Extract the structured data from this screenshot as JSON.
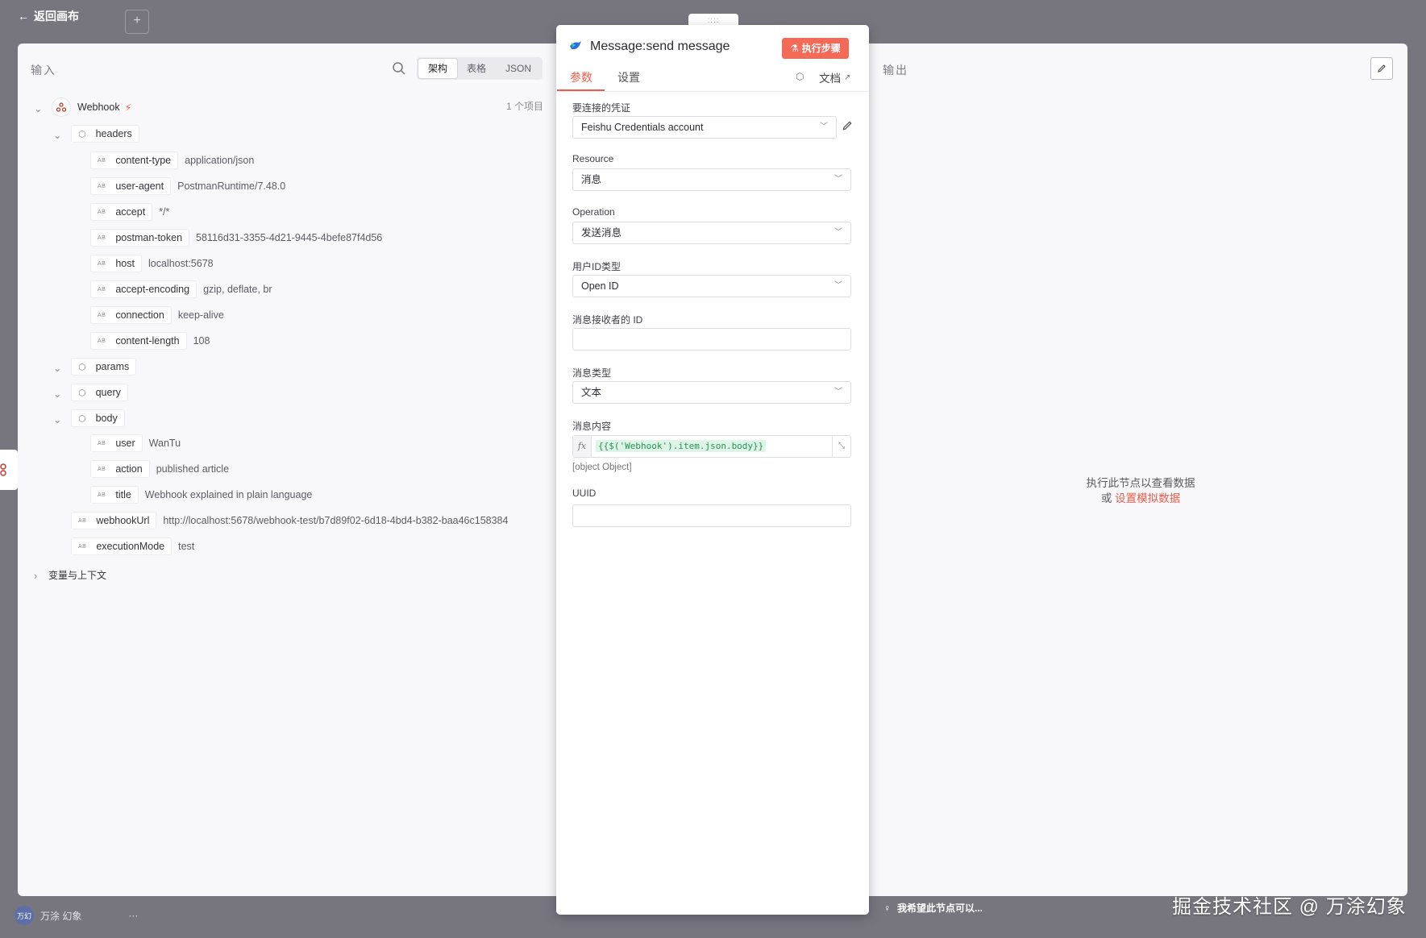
{
  "topbar": {
    "back_label": "返回画布",
    "plus_label": "+"
  },
  "input_panel": {
    "title": "输入",
    "view_tabs": [
      "架构",
      "表格",
      "JSON"
    ],
    "active_view": "架构",
    "item_count": "1 个项目",
    "root_node": "Webhook",
    "headers_label": "headers",
    "header_fields": [
      {
        "key": "content-type",
        "value": "application/json"
      },
      {
        "key": "user-agent",
        "value": "PostmanRuntime/7.48.0"
      },
      {
        "key": "accept",
        "value": "*/*"
      },
      {
        "key": "postman-token",
        "value": "58116d31-3355-4d21-9445-4befe87f4d56"
      },
      {
        "key": "host",
        "value": "localhost:5678"
      },
      {
        "key": "accept-encoding",
        "value": "gzip, deflate, br"
      },
      {
        "key": "connection",
        "value": "keep-alive"
      },
      {
        "key": "content-length",
        "value": "108"
      }
    ],
    "params_label": "params",
    "query_label": "query",
    "body_label": "body",
    "body_fields": [
      {
        "key": "user",
        "value": "WanTu"
      },
      {
        "key": "action",
        "value": "published article"
      },
      {
        "key": "title",
        "value": "Webhook explained in plain language"
      }
    ],
    "webhook_url": {
      "key": "webhookUrl",
      "value": "http://localhost:5678/webhook-test/b7d89f02-6d18-4bd4-b382-baa46c158384"
    },
    "execution_mode": {
      "key": "executionMode",
      "value": "test"
    },
    "vars_label": "变量与上下文",
    "type_badge": "AB"
  },
  "modal": {
    "drag_handle": "::::",
    "title": "Message:send message",
    "exec_button": "执行步骤",
    "tabs": [
      "参数",
      "设置"
    ],
    "docs_label": "文档",
    "fields": {
      "credential": {
        "label": "要连接的凭证",
        "value": "Feishu Credentials account"
      },
      "resource": {
        "label": "Resource",
        "value": "消息"
      },
      "operation": {
        "label": "Operation",
        "value": "发送消息"
      },
      "user_id_type": {
        "label": "用户ID类型",
        "value": "Open ID"
      },
      "receiver_id": {
        "label": "消息接收者的 ID",
        "value": ""
      },
      "msg_type": {
        "label": "消息类型",
        "value": "文本"
      },
      "msg_content": {
        "label": "消息内容",
        "expression": "{{$('Webhook').item.json.body}}",
        "result": "[object Object]",
        "fx": "fx"
      },
      "uuid": {
        "label": "UUID",
        "value": ""
      }
    }
  },
  "output_panel": {
    "title": "输出",
    "empty_line1": "执行此节点以查看数据",
    "empty_or": "或",
    "mock_link": "设置模拟数据"
  },
  "bottom": {
    "avatar_text": "万幻",
    "user_name": "万涂 幻象",
    "more": "···",
    "feedback": "我希望此节点可以...",
    "watermark": "掘金技术社区 @ 万涂幻象"
  },
  "colors": {
    "accent": "#ef5c4b",
    "overlay": "#77767f",
    "panel_bg": "#f8f8fa"
  }
}
